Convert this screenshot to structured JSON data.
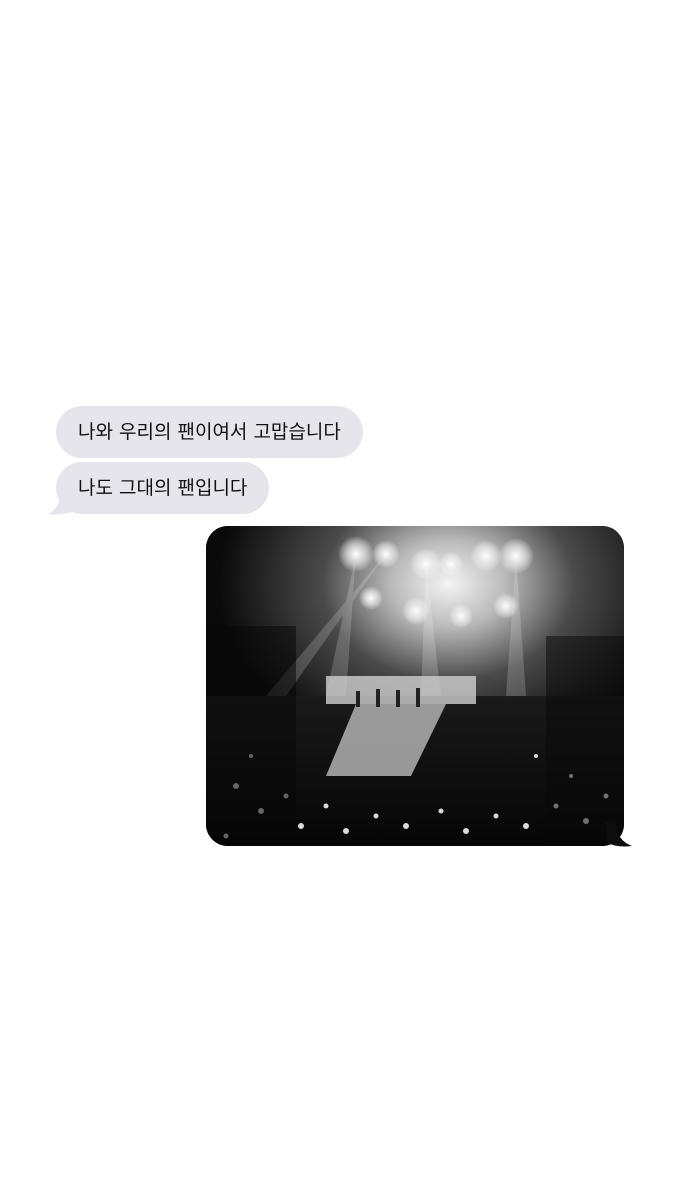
{
  "conversation": {
    "messages": [
      {
        "direction": "incoming",
        "type": "text",
        "text": "나와 우리의 팬이여서 고맙습니다"
      },
      {
        "direction": "incoming",
        "type": "text",
        "text": "나도 그대의 팬입니다"
      },
      {
        "direction": "outgoing",
        "type": "photo",
        "subject": "concert-stage-photo"
      }
    ]
  },
  "colors": {
    "background": "#ffffff",
    "incoming_bubble": "#e6e5eb",
    "incoming_text": "#111111",
    "photo_dark": "#0d0d0d"
  }
}
